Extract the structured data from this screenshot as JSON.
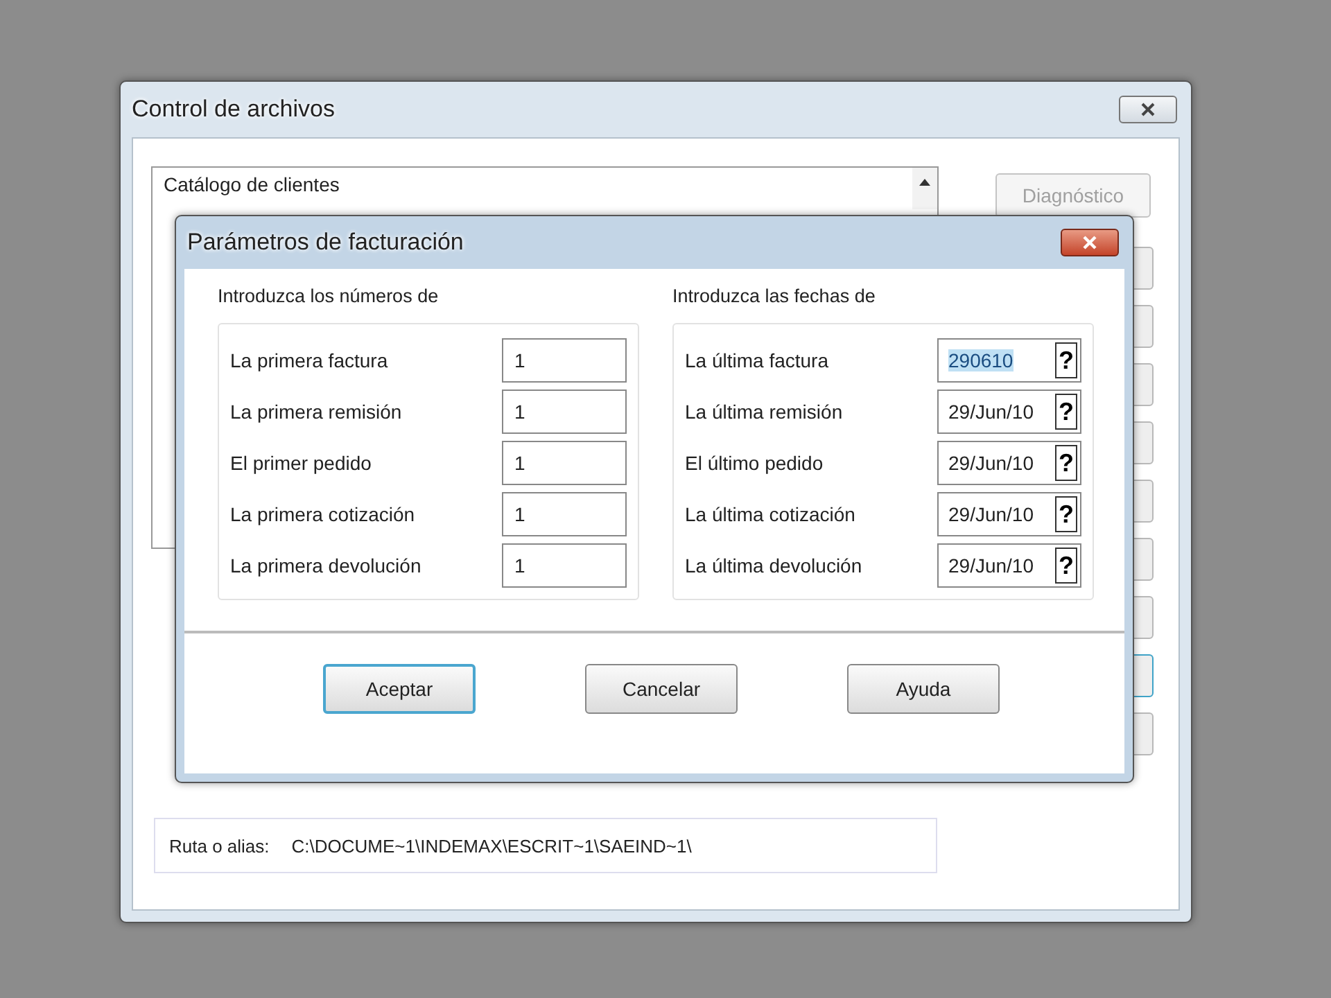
{
  "back_window": {
    "title": "Control de archivos",
    "list_items": [
      "Catálogo de clientes"
    ],
    "buttons": [
      {
        "label": "Diagnóstico",
        "disabled": true
      }
    ],
    "path_label": "Ruta o alias:",
    "path_value": "C:\\DOCUME~1\\INDEMAX\\ESCRIT~1\\SAEIND~1\\"
  },
  "dialog": {
    "title": "Parámetros de facturación",
    "numbers": {
      "heading": "Introduzca los números de",
      "rows": [
        {
          "label": "La primera factura",
          "value": "1"
        },
        {
          "label": "La primera remisión",
          "value": "1"
        },
        {
          "label": "El primer pedido",
          "value": "1"
        },
        {
          "label": "La primera cotización",
          "value": "1"
        },
        {
          "label": "La primera devolución",
          "value": "1"
        }
      ]
    },
    "dates": {
      "heading": "Introduzca las fechas de",
      "rows": [
        {
          "label": "La última factura",
          "value": "290610",
          "highlighted": true,
          "button": "?"
        },
        {
          "label": "La última remisión",
          "value": "29/Jun/10",
          "highlighted": false,
          "button": "?"
        },
        {
          "label": "El último pedido",
          "value": "29/Jun/10",
          "highlighted": false,
          "button": "?"
        },
        {
          "label": "La última cotización",
          "value": "29/Jun/10",
          "highlighted": false,
          "button": "?"
        },
        {
          "label": "La última devolución",
          "value": "29/Jun/10",
          "highlighted": false,
          "button": "?"
        }
      ]
    },
    "buttons": [
      {
        "label": "Aceptar",
        "default": true
      },
      {
        "label": "Cancelar",
        "default": false
      },
      {
        "label": "Ayuda",
        "default": false
      }
    ]
  }
}
